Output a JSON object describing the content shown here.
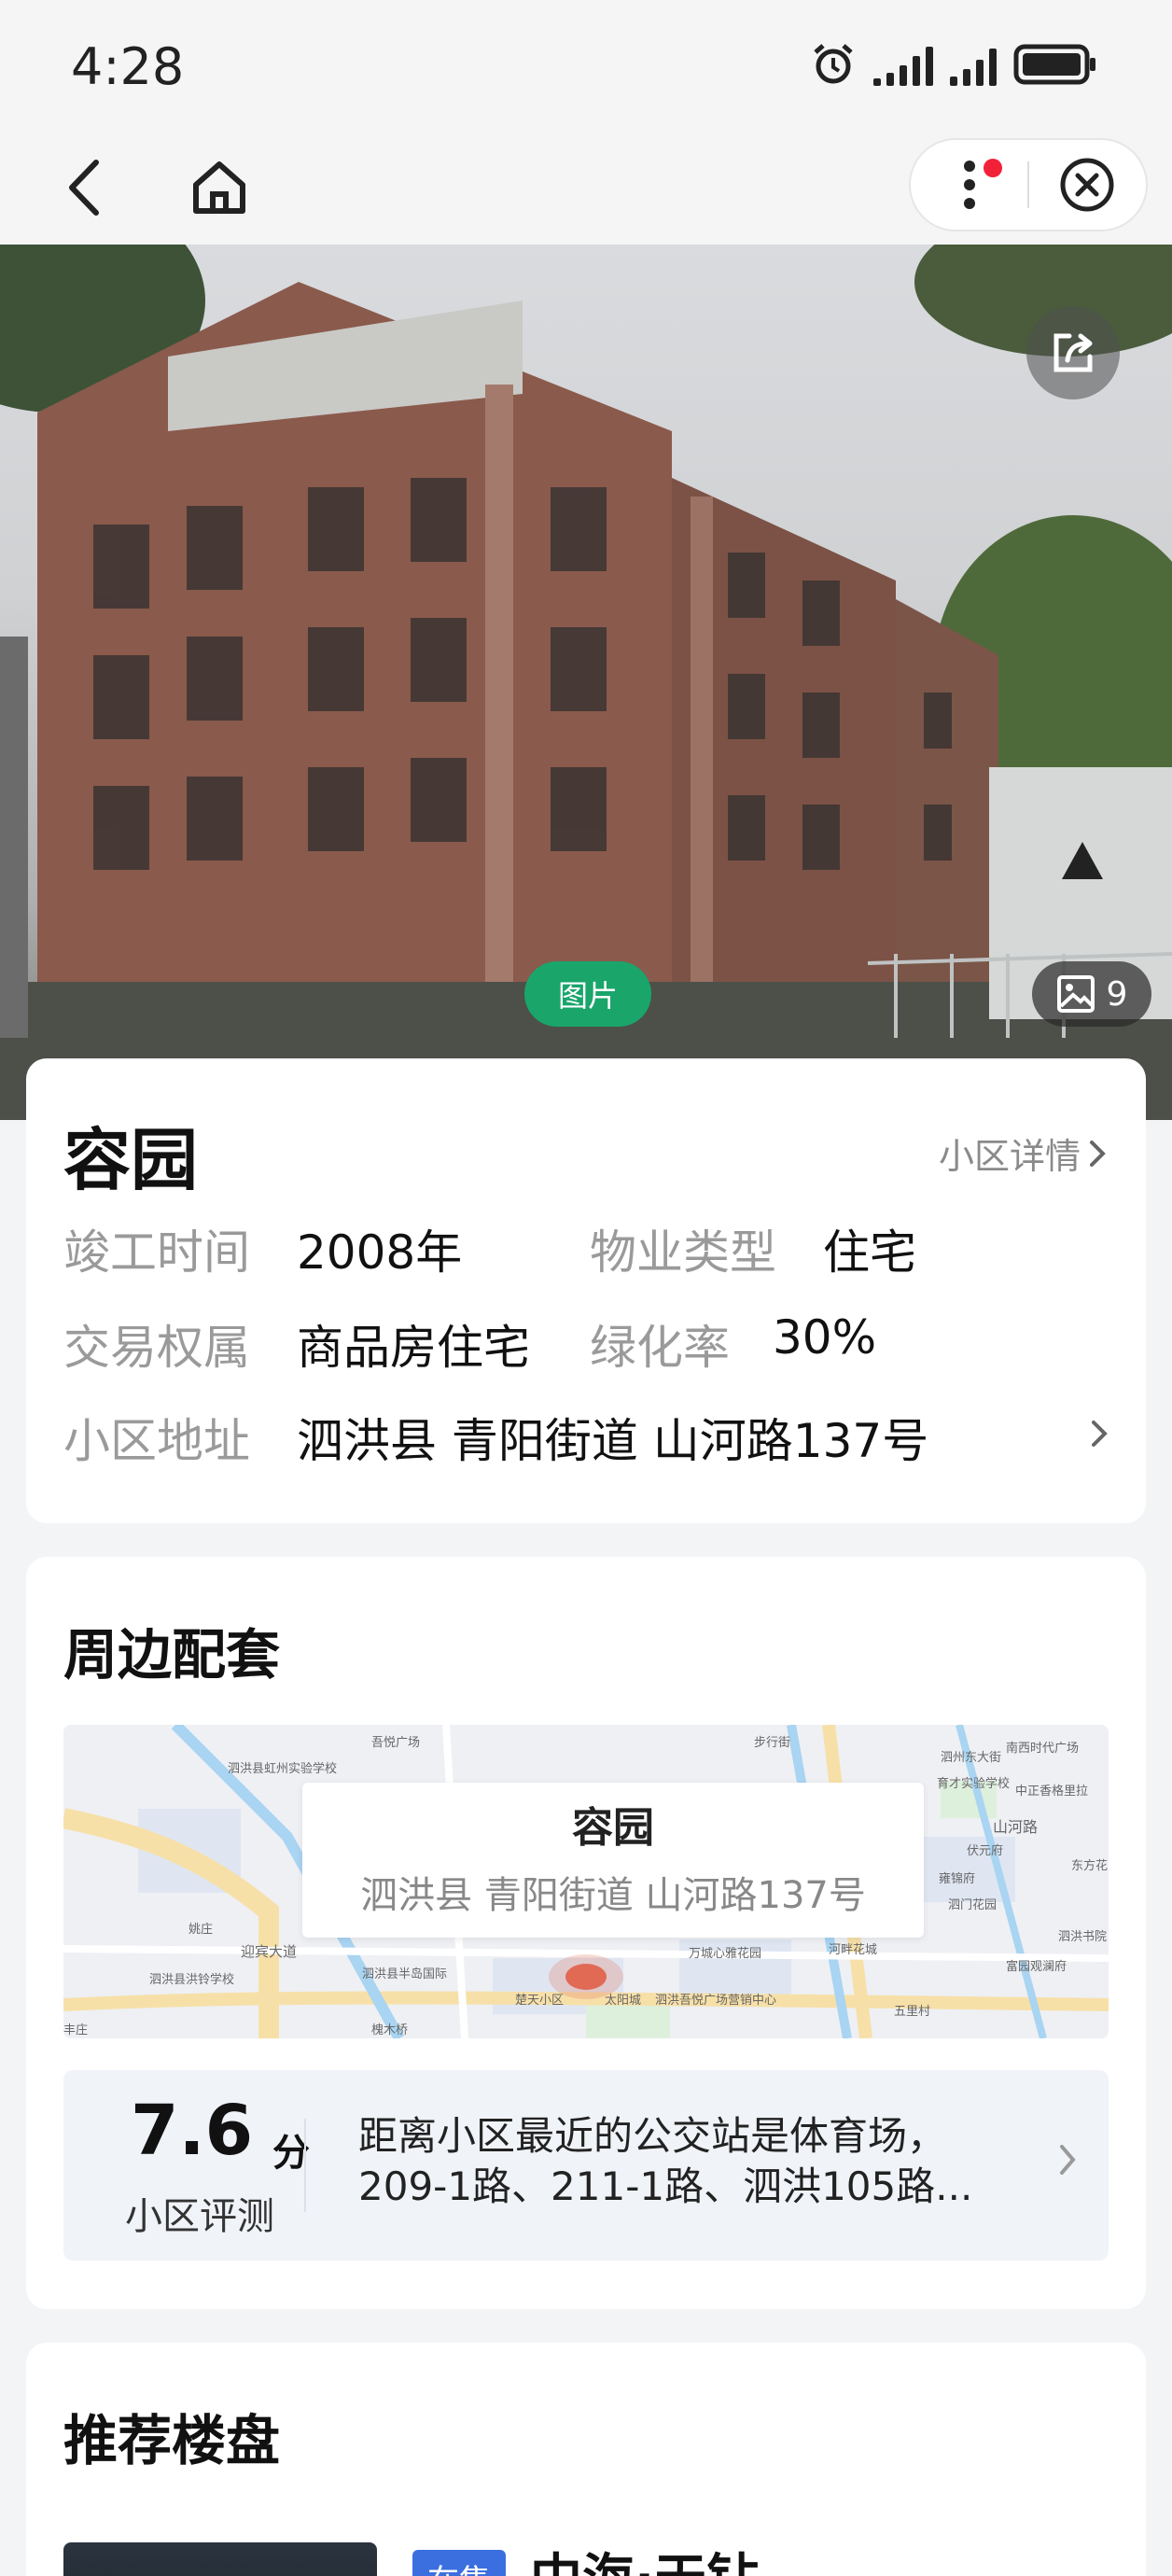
{
  "status_bar": {
    "time": "4:28"
  },
  "hero": {
    "photo_label": "图片",
    "photo_count": "9"
  },
  "community": {
    "name": "容园",
    "detail_link": "小区详情",
    "completion_label": "竣工时间",
    "completion_value": "2008年",
    "property_type_label": "物业类型",
    "property_type_value": "住宅",
    "ownership_label": "交易权属",
    "ownership_value": "商品房住宅",
    "greening_label": "绿化率",
    "greening_value": "30%",
    "address_label": "小区地址",
    "address_value": "泗洪县 青阳街道 山河路137号"
  },
  "surroundings": {
    "title": "周边配套",
    "map_popup_name": "容园",
    "map_popup_address": "泗洪县 青阳街道 山河路137号",
    "map_labels": [
      "泗洪县虹州实验学校",
      "吾悦广场",
      "步行街",
      "南西时代广场",
      "泗州东大街",
      "育才实验学校",
      "中正香格里拉",
      "山河路",
      "伏元府",
      "东方花",
      "雍锦府",
      "泗门花园",
      "泗洪书院",
      "富园观澜府",
      "河畔花城",
      "万城心雅花园",
      "泗洪县洪铃学校",
      "泗洪县半岛国际",
      "楚天小区",
      "太阳城",
      "泗洪吾悦广场营销中心",
      "五里村",
      "迎宾大道",
      "姚庄",
      "丰庄",
      "槐木桥"
    ],
    "score_value": "7.6",
    "score_unit": "分",
    "score_label": "小区评测",
    "transit_text": "距离小区最近的公交站是体育场，209-1路、211-1路、泗洪105路..."
  },
  "recommend": {
    "title": "推荐楼盘",
    "tag": "在售",
    "first_name": "中海·天钻"
  }
}
